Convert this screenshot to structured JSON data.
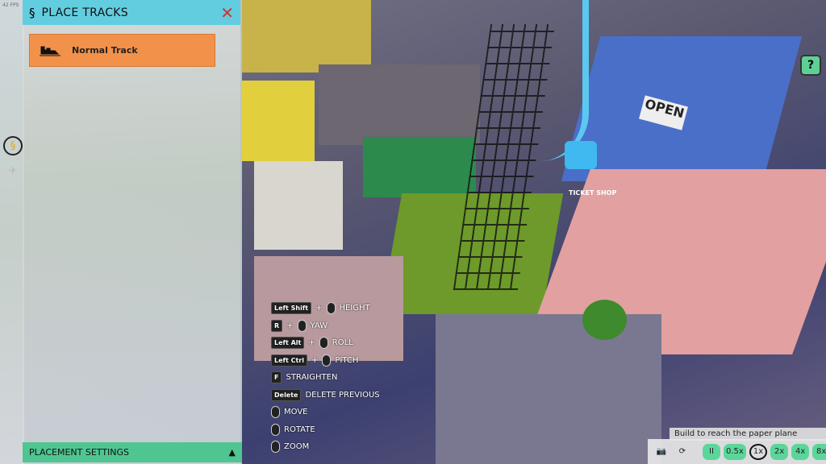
{
  "hud": {
    "fps": "42 FPS"
  },
  "panel": {
    "title": "PLACE TRACKS",
    "close_icon": "close-x-icon",
    "track_option": "Normal Track",
    "placement_settings": "PLACEMENT SETTINGS",
    "collapse_icon": "triangle-up-icon"
  },
  "side_tools": [
    {
      "icon": "coaster-track-icon",
      "active": true
    },
    {
      "icon": "paper-plane-icon",
      "active": false
    }
  ],
  "controls": [
    {
      "keys": [
        "Left Shift"
      ],
      "mouse": true,
      "label": "HEIGHT"
    },
    {
      "keys": [
        "R"
      ],
      "mouse": true,
      "label": "YAW"
    },
    {
      "keys": [
        "Left Alt"
      ],
      "mouse": true,
      "label": "ROLL"
    },
    {
      "keys": [
        "Left Ctrl"
      ],
      "mouse": true,
      "label": "PITCH"
    },
    {
      "keys": [
        "F"
      ],
      "mouse": false,
      "label": "STRAIGHTEN"
    },
    {
      "keys": [
        "Delete"
      ],
      "mouse": false,
      "label": "DELETE PREVIOUS"
    },
    {
      "keys": [],
      "mouse": true,
      "label": "MOVE"
    },
    {
      "keys": [],
      "mouse": true,
      "label": "ROTATE"
    },
    {
      "keys": [],
      "mouse": true,
      "label": "ZOOM"
    }
  ],
  "objective": "Build to reach the paper plane",
  "speed": {
    "pause": "II",
    "options": [
      "0.5x",
      "1x",
      "2x",
      "4x",
      "8x"
    ],
    "selected": "1x"
  },
  "help": "?",
  "scene": {
    "sign_open": "OPEN",
    "sign_ticket": "TICKET SHOP"
  },
  "colors": {
    "header": "#63cde0",
    "option": "#f2914a",
    "settings": "#4fc692",
    "speed": "#5bd69a"
  }
}
